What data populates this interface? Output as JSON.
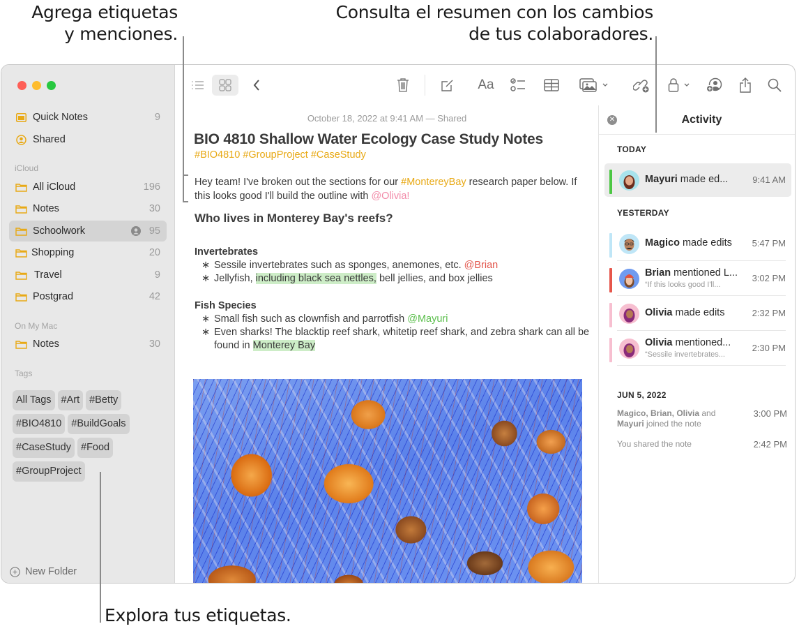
{
  "callouts": {
    "tags_mentions": [
      "Agrega etiquetas",
      "y menciones."
    ],
    "activity_summary": [
      "Consulta el resumen con los cambios",
      "de tus colaboradores."
    ],
    "browse_tags": "Explora tus etiquetas."
  },
  "sidebar": {
    "pinned": [
      {
        "label": "Quick Notes",
        "count": "9",
        "icon": "quick-notes-icon"
      },
      {
        "label": "Shared",
        "count": "",
        "icon": "shared-person-icon"
      }
    ],
    "sections": [
      {
        "label": "iCloud",
        "items": [
          {
            "label": "All iCloud",
            "count": "196",
            "icon": "folder-icon"
          },
          {
            "label": "Notes",
            "count": "30",
            "icon": "folder-icon"
          },
          {
            "label": "Schoolwork",
            "count": "95",
            "icon": "folder-icon",
            "selected": true,
            "shared": true
          },
          {
            "label": "Shopping",
            "count": "20",
            "icon": "folder-icon"
          },
          {
            "label": "Travel",
            "count": "9",
            "icon": "folder-icon"
          },
          {
            "label": "Postgrad",
            "count": "42",
            "icon": "folder-icon"
          }
        ]
      },
      {
        "label": "On My Mac",
        "items": [
          {
            "label": "Notes",
            "count": "30",
            "icon": "folder-icon"
          }
        ]
      }
    ],
    "tags_label": "Tags",
    "tags": [
      "All Tags",
      "#Art",
      "#Betty",
      "#BIO4810",
      "#BuildGoals",
      "#CaseStudy",
      "#Food",
      "#GroupProject"
    ],
    "new_folder": "New Folder"
  },
  "toolbar": {
    "icons": [
      "list-view-icon",
      "gallery-view-icon",
      "back-chevron-icon",
      "trash-icon",
      "compose-icon",
      "format-text-icon",
      "checklist-icon",
      "table-icon",
      "media-icon",
      "collaborate-link-icon",
      "lock-icon",
      "add-people-icon",
      "share-icon",
      "search-icon"
    ],
    "format_label": "Aa"
  },
  "note": {
    "date": "October 18, 2022 at 9:41 AM — Shared",
    "title": "BIO 4810 Shallow Water Ecology Case Study Notes",
    "hashtags": "#BIO4810 #GroupProject #CaseStudy",
    "intro": {
      "p1": "Hey team! I've broken out the sections for our ",
      "hash": "#MontereyBay",
      "p2": " research paper below. If this looks good I'll build the outline with ",
      "mention": "@Olivia!"
    },
    "heading": "Who lives in Monterey Bay's reefs?",
    "invertebrates": {
      "heading": "Invertebrates",
      "b1_text": "Sessile invertebrates such as sponges, anemones, etc. ",
      "b1_mention": "@Brian",
      "b2_pre": "Jellyfish, ",
      "b2_highlight": "including black sea nettles,",
      "b2_post": " bell jellies, and box jellies"
    },
    "fish": {
      "heading": "Fish Species",
      "b1_text": "Small fish such as clownfish and parrotfish ",
      "b1_mention": "@Mayuri",
      "b2_pre": "Even sharks! The blacktip reef shark, whitetip reef shark, and zebra shark can all be found in ",
      "b2_highlight": "Monterey Bay"
    },
    "image_alt": "Sea nettle jellyfish photo"
  },
  "activity": {
    "title": "Activity",
    "sections": {
      "today": "TODAY",
      "yesterday": "YESTERDAY",
      "jun": "JUN 5, 2022"
    },
    "items": [
      {
        "name": "Mayuri",
        "action": " made ed...",
        "time": "9:41 AM",
        "color": "#4cc744",
        "sub": ""
      },
      {
        "name": "Magico",
        "action": " made edits",
        "time": "5:47 PM",
        "color": "#bfe6f7",
        "sub": ""
      },
      {
        "name": "Brian",
        "action": " mentioned L...",
        "time": "3:02 PM",
        "color": "#e6564b",
        "sub": "“If this looks good I'll..."
      },
      {
        "name": "Olivia",
        "action": " made edits",
        "time": "2:32 PM",
        "color": "#f7bfd0",
        "sub": ""
      },
      {
        "name": "Olivia",
        "action": " mentioned...",
        "time": "2:30 PM",
        "color": "#f7bfd0",
        "sub": "“Sessile invertebrates..."
      }
    ],
    "joined": {
      "names": "Magico, Brian, Olivia",
      "and": " and ",
      "last": "Mayuri",
      "rest": " joined the note",
      "time": "3:00 PM"
    },
    "shared": {
      "text": "You shared the note",
      "time": "2:42 PM"
    }
  }
}
